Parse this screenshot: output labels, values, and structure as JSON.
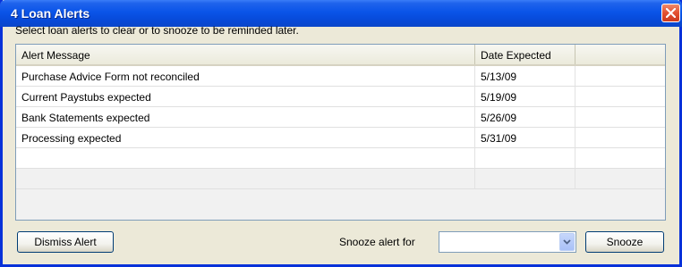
{
  "window": {
    "title": "4 Loan Alerts"
  },
  "instruction": "Select loan alerts to clear or to snooze to be reminded later.",
  "table": {
    "columns": [
      "Alert Message",
      "Date Expected",
      ""
    ],
    "rows": [
      {
        "message": "Purchase Advice Form not reconciled",
        "date": "5/13/09"
      },
      {
        "message": "Current Paystubs expected",
        "date": "5/19/09"
      },
      {
        "message": "Bank Statements expected",
        "date": "5/26/09"
      },
      {
        "message": "Processing expected",
        "date": "5/31/09"
      }
    ]
  },
  "footer": {
    "dismiss_label": "Dismiss Alert",
    "snooze_for_label": "Snooze alert for",
    "snooze_select_value": "",
    "snooze_label": "Snooze"
  },
  "icons": {
    "close": "close-icon",
    "dropdown": "chevron-down-icon"
  },
  "colors": {
    "titlebar": "#0a54e8",
    "close_button": "#e25030",
    "window_bg": "#ece9d8"
  }
}
